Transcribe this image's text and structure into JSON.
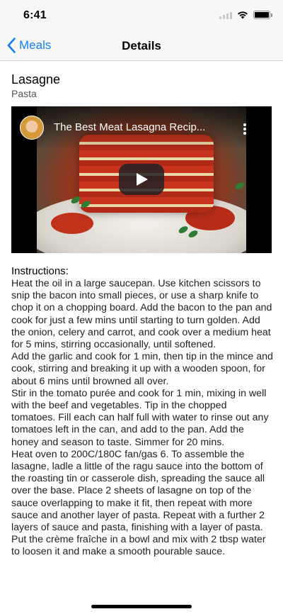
{
  "status_bar": {
    "time": "6:41",
    "icons": [
      "signal-icon",
      "wifi-icon",
      "battery-icon"
    ]
  },
  "nav": {
    "back_label": "Meals",
    "title": "Details",
    "accent_color": "#147efb"
  },
  "meal": {
    "name": "Lasagne",
    "category": "Pasta"
  },
  "video": {
    "title": "The Best Meat Lasagna Recip..."
  },
  "instructions": {
    "heading": "Instructions:",
    "paragraphs": [
      "Heat the oil in a large saucepan. Use kitchen scissors to snip the bacon into small pieces, or use a sharp knife to chop it on a chopping board. Add the bacon to the pan and cook for just a few mins until starting to turn golden. Add the onion, celery and carrot, and cook over a medium heat for 5 mins, stirring occasionally, until softened.",
      "Add the garlic and cook for 1 min, then tip in the mince and cook, stirring and breaking it up with a wooden spoon, for about 6 mins until browned all over.",
      "Stir in the tomato purée and cook for 1 min, mixing in well with the beef and vegetables. Tip in the chopped tomatoes. Fill each can half full with water to rinse out any tomatoes left in the can, and add to the pan. Add the honey and season to taste. Simmer for 20 mins.",
      "Heat oven to 200C/180C fan/gas 6. To assemble the lasagne, ladle a little of the ragu sauce into the bottom of the roasting tin or casserole dish, spreading the sauce all over the base. Place 2 sheets of lasagne on top of the sauce overlapping to make it fit, then repeat with more sauce and another layer of pasta. Repeat with a further 2 layers of sauce and pasta, finishing with a layer of pasta.",
      "Put the crème fraîche in a bowl and mix with 2 tbsp water to loosen it and make a smooth pourable sauce."
    ]
  }
}
